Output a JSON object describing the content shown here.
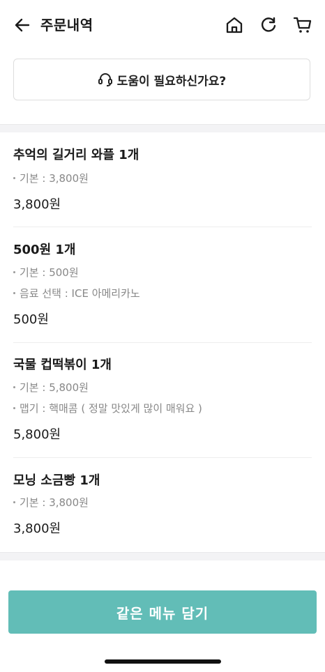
{
  "header": {
    "title": "주문내역",
    "icons": [
      "back-arrow-icon",
      "home-icon",
      "refresh-icon",
      "cart-icon"
    ]
  },
  "help": {
    "label": "도움이 필요하신가요?",
    "icon": "headset-icon"
  },
  "items": [
    {
      "name": "추억의 길거리 와플 1개",
      "options": [
        "기본 : 3,800원"
      ],
      "price": "3,800원"
    },
    {
      "name": "500원 1개",
      "options": [
        "기본 : 500원",
        "음료 선택 : ICE 아메리카노"
      ],
      "price": "500원"
    },
    {
      "name": "국물 컵떡볶이 1개",
      "options": [
        "기본 : 5,800원",
        "맵기 : 핵매콤 ( 정말 맛있게 많이 매워요 )"
      ],
      "price": "5,800원"
    },
    {
      "name": "모닝 소금빵 1개",
      "options": [
        "기본 : 3,800원"
      ],
      "price": "3,800원"
    }
  ],
  "reorder_button": {
    "label": "같은 메뉴 담기"
  },
  "colors": {
    "accent": "#62bdb7",
    "divider": "#ededed",
    "muted_text": "#888888"
  }
}
